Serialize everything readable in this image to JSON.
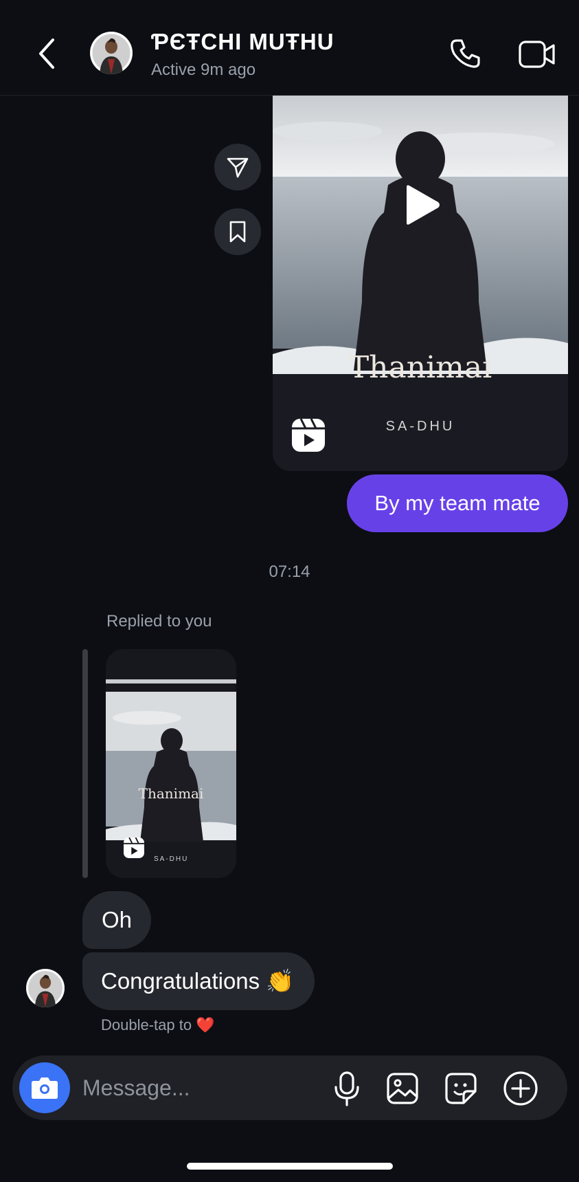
{
  "header": {
    "contact_name": "ƤЄŦCHI MUŦHU",
    "status": "Active 9m ago"
  },
  "reel": {
    "title": "Thanimai",
    "author": "SA-DHU"
  },
  "messages": {
    "outgoing_text": "By my team mate",
    "timestamp": "07:14",
    "replied_label": "Replied to you",
    "reply_thumb_title": "Thanimai",
    "reply_thumb_author": "SA-DHU",
    "incoming_1": "Oh",
    "incoming_2": "Congratulations 👏",
    "double_tap_hint": "Double-tap to ❤️"
  },
  "composer": {
    "placeholder": "Message..."
  },
  "icons": {
    "back": "chevron-left-icon",
    "call": "phone-icon",
    "video": "video-camera-icon",
    "share": "send-icon",
    "save": "bookmark-icon",
    "play": "play-icon",
    "reels": "reels-icon",
    "camera": "camera-icon",
    "mic": "microphone-icon",
    "gallery": "gallery-icon",
    "sticker": "sticker-icon",
    "add": "plus-circle-icon"
  },
  "colors": {
    "background": "#0c0e13",
    "outgoing_bubble": "#6741e8",
    "incoming_bubble": "#26282f",
    "camera_button": "#3a73f5"
  }
}
